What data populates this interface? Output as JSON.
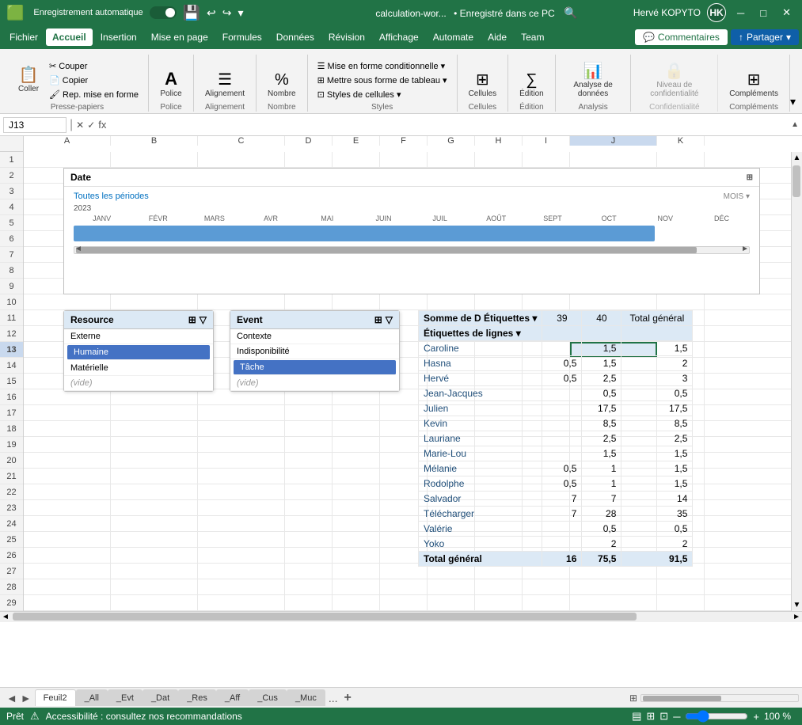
{
  "titlebar": {
    "autosave_label": "Enregistrement automatique",
    "filename": "calculation-wor...",
    "saved_label": "• Enregistré dans ce PC",
    "user_name": "Hervé KOPYTO",
    "user_initials": "HK",
    "minimize": "─",
    "maximize": "□",
    "close": "✕"
  },
  "menubar": {
    "items": [
      "Fichier",
      "Accueil",
      "Insertion",
      "Mise en page",
      "Formules",
      "Données",
      "Révision",
      "Affichage",
      "Automate",
      "Aide",
      "Team"
    ],
    "active": "Accueil",
    "comments_btn": "Commentaires",
    "share_btn": "Partager"
  },
  "ribbon": {
    "groups": [
      {
        "name": "Presse-papiers",
        "buttons": [
          {
            "label": "Coller",
            "icon": "📋"
          },
          {
            "label": "Police",
            "icon": "A"
          },
          {
            "label": "Alignement",
            "icon": "≡"
          },
          {
            "label": "Nombre",
            "icon": "%"
          }
        ]
      },
      {
        "name": "Styles",
        "buttons": [
          {
            "label": "Mise en forme conditionnelle ▾",
            "small": true
          },
          {
            "label": "Mettre sous forme de tableau ▾",
            "small": true
          },
          {
            "label": "Styles de cellules ▾",
            "small": true
          }
        ]
      },
      {
        "name": "Cellules",
        "buttons": [
          {
            "label": "Cellules",
            "icon": "⊞"
          }
        ]
      },
      {
        "name": "Édition",
        "buttons": [
          {
            "label": "Édition",
            "icon": "∑"
          }
        ]
      },
      {
        "name": "Analysis",
        "buttons": [
          {
            "label": "Analyse de données",
            "icon": "📊"
          }
        ]
      },
      {
        "name": "Confidentialité",
        "buttons": [
          {
            "label": "Niveau de confidentialité",
            "icon": "🔒",
            "disabled": true
          }
        ]
      },
      {
        "name": "Compléments",
        "buttons": [
          {
            "label": "Compléments",
            "icon": "⊞"
          }
        ]
      }
    ]
  },
  "formula_bar": {
    "cell_ref": "J13",
    "formula": ""
  },
  "columns": {
    "headers": [
      "A",
      "B",
      "C",
      "D",
      "E",
      "F",
      "G",
      "H",
      "I",
      "J",
      "K"
    ],
    "widths": [
      30,
      110,
      110,
      110,
      60,
      60,
      60,
      60,
      60,
      110,
      60
    ]
  },
  "rows": {
    "count": 29,
    "active": 13
  },
  "date_slicer": {
    "title": "Date",
    "period_label": "Toutes les périodes",
    "year": "2023",
    "mois_label": "MOIS ▾",
    "months": [
      "JANV",
      "FÉVR",
      "MARS",
      "AVR",
      "MAI",
      "JUIN",
      "JUIL",
      "AOÛT",
      "SEPT",
      "OCT",
      "NOV",
      "DÉC"
    ]
  },
  "resource_slicer": {
    "title": "Resource",
    "items": [
      {
        "label": "Externe",
        "selected": false
      },
      {
        "label": "Humaine",
        "selected": true
      },
      {
        "label": "Matérielle",
        "selected": false
      },
      {
        "label": "(vide)",
        "selected": false,
        "ghost": true
      }
    ]
  },
  "event_slicer": {
    "title": "Event",
    "items": [
      {
        "label": "Contexte",
        "selected": false
      },
      {
        "label": "Indisponibilité",
        "selected": false
      },
      {
        "label": "Tâche",
        "selected": true
      },
      {
        "label": "(vide)",
        "selected": false,
        "ghost": true
      }
    ]
  },
  "pivot_table": {
    "corner_label": "Somme de D Étiquettes de colonnes",
    "filter_icon": "▾",
    "row_header": "Étiquettes de lignes",
    "col_headers": [
      "39",
      "40",
      "Total général"
    ],
    "rows": [
      {
        "name": "Caroline",
        "v39": "",
        "v40": "1,5",
        "total": "1,5"
      },
      {
        "name": "Hasna",
        "v39": "0,5",
        "v40": "1,5",
        "total": "2"
      },
      {
        "name": "Hervé",
        "v39": "0,5",
        "v40": "2,5",
        "total": "3"
      },
      {
        "name": "Jean-Jacques",
        "v39": "",
        "v40": "0,5",
        "total": "0,5"
      },
      {
        "name": "Julien",
        "v39": "",
        "v40": "17,5",
        "total": "17,5"
      },
      {
        "name": "Kevin",
        "v39": "",
        "v40": "8,5",
        "total": "8,5"
      },
      {
        "name": "Lauriane",
        "v39": "",
        "v40": "2,5",
        "total": "2,5"
      },
      {
        "name": "Marie-Lou",
        "v39": "",
        "v40": "1,5",
        "total": "1,5"
      },
      {
        "name": "Mélanie",
        "v39": "0,5",
        "v40": "1",
        "total": "1,5"
      },
      {
        "name": "Rodolphe",
        "v39": "0,5",
        "v40": "1",
        "total": "1,5"
      },
      {
        "name": "Salvador",
        "v39": "7",
        "v40": "7",
        "total": "14"
      },
      {
        "name": "Télécharger",
        "v39": "7",
        "v40": "28",
        "total": "35"
      },
      {
        "name": "Valérie",
        "v39": "",
        "v40": "0,5",
        "total": "0,5"
      },
      {
        "name": "Yoko",
        "v39": "",
        "v40": "2",
        "total": "2"
      }
    ],
    "total_row": {
      "name": "Total général",
      "v39": "16",
      "v40": "75,5",
      "total": "91,5"
    }
  },
  "sheet_tabs": {
    "tabs": [
      "Feuil2",
      "_All",
      "_Evt",
      "_Dat",
      "_Res",
      "_Aff",
      "_Cus",
      "_Muc"
    ],
    "active": "Feuil2",
    "more": "...",
    "add": "+"
  },
  "statusbar": {
    "status": "Prêt",
    "accessibility": "Accessibilité : consultez nos recommandations",
    "zoom": "100 %"
  }
}
